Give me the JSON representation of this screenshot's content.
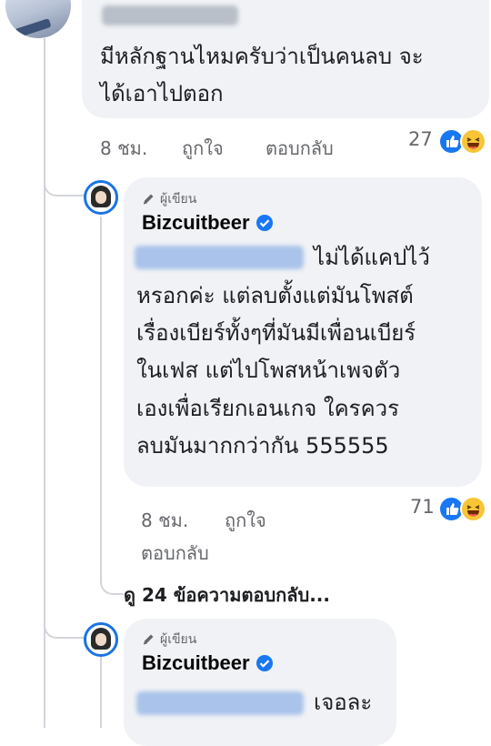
{
  "comment1": {
    "text_line1": "มีหลักฐานไหมครับว่าเป็นคนลบ จะ",
    "text_line2": "ได้เอาไปตอก",
    "time": "8 ชม.",
    "like_label": "ถูกใจ",
    "reply_label": "ตอบกลับ",
    "reaction_count": "27",
    "reactions": [
      "like-icon",
      "haha-icon"
    ]
  },
  "reply1": {
    "badge": "ผู้เขียน",
    "author": "Bizcuitbeer",
    "text_lines": [
      "ไม่ได้แคปไว้",
      "หรอกค่ะ แต่ลบตั้งแต่มันโพสต์",
      "เรื่องเบียร์ทั้งๆที่มันมีเพื่อนเบียร์",
      "ในเฟส แต่ไปโพสหน้าเพจตัว",
      "เองเพื่อเรียกเอนเกจ ใครควร",
      "ลบมันมากกว่ากัน 555555"
    ],
    "time": "8 ชม.",
    "like_label": "ถูกใจ",
    "reply_label": "ตอบกลับ",
    "reaction_count": "71",
    "reactions": [
      "like-icon",
      "haha-icon"
    ]
  },
  "view_more_replies": "ดู 24 ข้อความตอบกลับ...",
  "reply2": {
    "badge": "ผู้เขียน",
    "author": "Bizcuitbeer",
    "text": "เจอละ"
  },
  "colors": {
    "bubble_bg": "#f0f2f5",
    "meta_text": "#65676b",
    "like_blue": "#1877f2",
    "haha_yellow": "#f7c536",
    "author_ring": "#1b74e4"
  }
}
